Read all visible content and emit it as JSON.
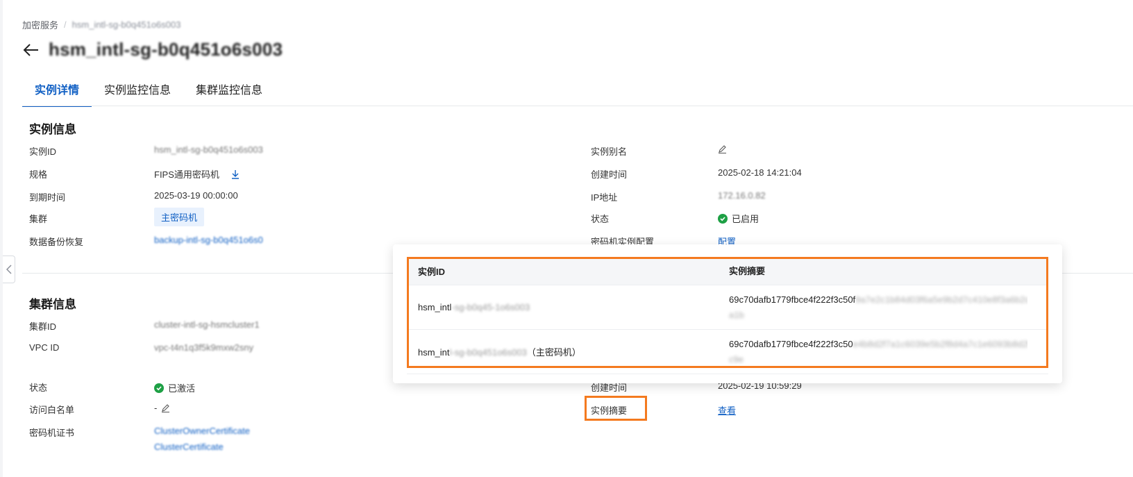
{
  "breadcrumb": {
    "root": "加密服务",
    "current": "hsm_intl-sg-b0q451o6s003"
  },
  "title": "hsm_intl-sg-b0q451o6s003",
  "tabs": [
    "实例详情",
    "实例监控信息",
    "集群监控信息"
  ],
  "instance_info": {
    "title": "实例信息",
    "instance_id": {
      "label": "实例ID",
      "value": "hsm_intl-sg-b0q451o6s003"
    },
    "spec": {
      "label": "规格",
      "value": "FIPS通用密码机"
    },
    "expire": {
      "label": "到期时间",
      "value": "2025-03-19 00:00:00"
    },
    "cluster": {
      "label": "集群",
      "value": "主密码机"
    },
    "backup": {
      "label": "数据备份恢复",
      "value": "backup-intl-sg-b0q451o6s0"
    },
    "alias": {
      "label": "实例别名"
    },
    "created": {
      "label": "创建时间",
      "value": "2025-02-18 14:21:04"
    },
    "ip": {
      "label": "IP地址",
      "value": "172.16.0.82"
    },
    "status": {
      "label": "状态",
      "value": "已启用"
    },
    "hsm_config": {
      "label": "密码机实例配置",
      "value": "配置"
    }
  },
  "cluster_info": {
    "title": "集群信息",
    "cluster_id": {
      "label": "集群ID",
      "value": "cluster-intl-sg-hsmcluster1"
    },
    "vpc_id": {
      "label": "VPC ID",
      "value": "vpc-t4n1q3f5k9mxw2sny"
    },
    "status": {
      "label": "状态",
      "value": "已激活"
    },
    "whitelist": {
      "label": "访问白名单",
      "value": "-"
    },
    "cert": {
      "label": "密码机证书",
      "value1": "ClusterOwnerCertificate",
      "value2": "ClusterCertificate"
    },
    "created": {
      "label": "创建时间",
      "value": "2025-02-19 10:59:29"
    },
    "digest": {
      "label": "实例摘要",
      "value": "查看"
    }
  },
  "popover": {
    "col1": "实例ID",
    "col2": "实例摘要",
    "rows": [
      {
        "id_visible": "hsm_intl",
        "id_hidden": "-sg-b0q45-1o6s003",
        "suffix": "",
        "digest_visible": "69c70dafb1779fbce4f222f3c50f",
        "digest_hidden": "9a7e2c1b84d03f6a5e9b2d7c410e8f3a6b2c9d0e1f",
        "digest_tail": "f",
        "digest_line2": "a1b"
      },
      {
        "id_visible": "hsm_int",
        "id_hidden": "l-sg-b0q451o6s003",
        "suffix": "（主密码机）",
        "digest_visible": "69c70dafb1779fbce4f222f3c50",
        "digest_hidden": "e4b8d2f7a1c6039e5b2f8d4a7c1e6093b8d2f5a7c1e",
        "digest_tail": "",
        "digest_line2": "c9e"
      }
    ]
  }
}
